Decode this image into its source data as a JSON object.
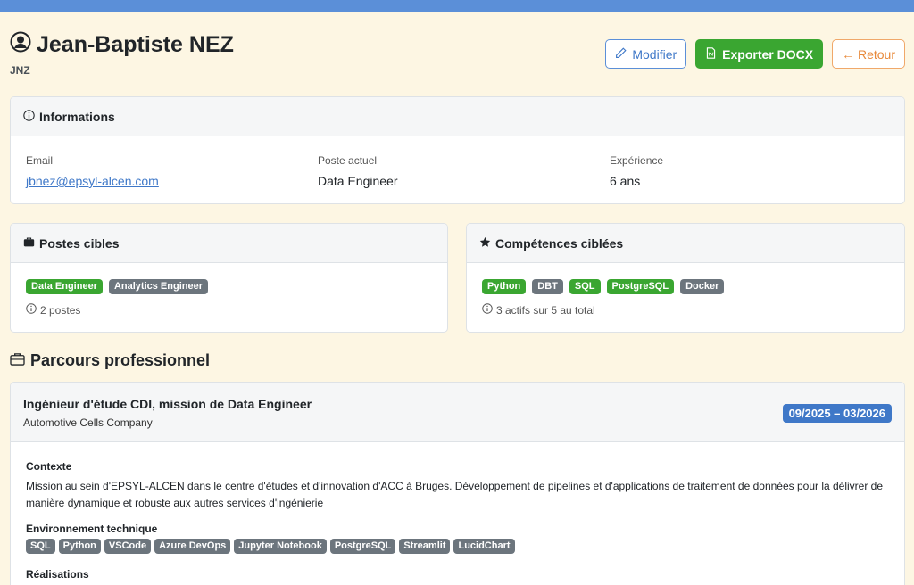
{
  "colors": {
    "topbar": "#5b8fd8",
    "page_bg": "#fdf6e3",
    "success": "#3aa631",
    "primary": "#3f78c8",
    "secondary": "#6c757d",
    "warning": "#e8893a"
  },
  "header": {
    "name": "Jean-Baptiste NEZ",
    "initials": "JNZ",
    "icon": "user-circle-icon",
    "actions": {
      "edit": "Modifier",
      "export": "Exporter DOCX",
      "back": "← Retour"
    }
  },
  "informations": {
    "title": "Informations",
    "email_label": "Email",
    "email_value": "jbnez@epsyl-alcen.com",
    "poste_label": "Poste actuel",
    "poste_value": "Data Engineer",
    "experience_label": "Expérience",
    "experience_value": "6 ans"
  },
  "postes_cibles": {
    "title": "Postes cibles",
    "tags": [
      {
        "label": "Data Engineer",
        "active": true
      },
      {
        "label": "Analytics Engineer",
        "active": false
      }
    ],
    "note": "2 postes"
  },
  "competences": {
    "title": "Compétences ciblées",
    "tags": [
      {
        "label": "Python",
        "active": true
      },
      {
        "label": "DBT",
        "active": false
      },
      {
        "label": "SQL",
        "active": true
      },
      {
        "label": "PostgreSQL",
        "active": true
      },
      {
        "label": "Docker",
        "active": false
      }
    ],
    "note": "3 actifs sur 5 au total"
  },
  "parcours": {
    "title": "Parcours professionnel",
    "experience": {
      "title": "Ingénieur d'étude CDI, mission de Data Engineer",
      "company": "Automotive Cells Company",
      "dates": "09/2025 – 03/2026",
      "context_label": "Contexte",
      "context_text": "Mission au sein d'EPSYL-ALCEN dans le centre d'études et d'innovation d'ACC à Bruges. Développement de pipelines et d'applications de traitement de données pour la délivrer de manière dynamique et robuste aux autres services d'ingénierie",
      "env_label": "Environnement technique",
      "env_tags": [
        "SQL",
        "Python",
        "VSCode",
        "Azure DevOps",
        "Jupyter Notebook",
        "PostgreSQL",
        "Streamlit",
        "LucidChart"
      ],
      "realisations_label": "Réalisations"
    }
  }
}
